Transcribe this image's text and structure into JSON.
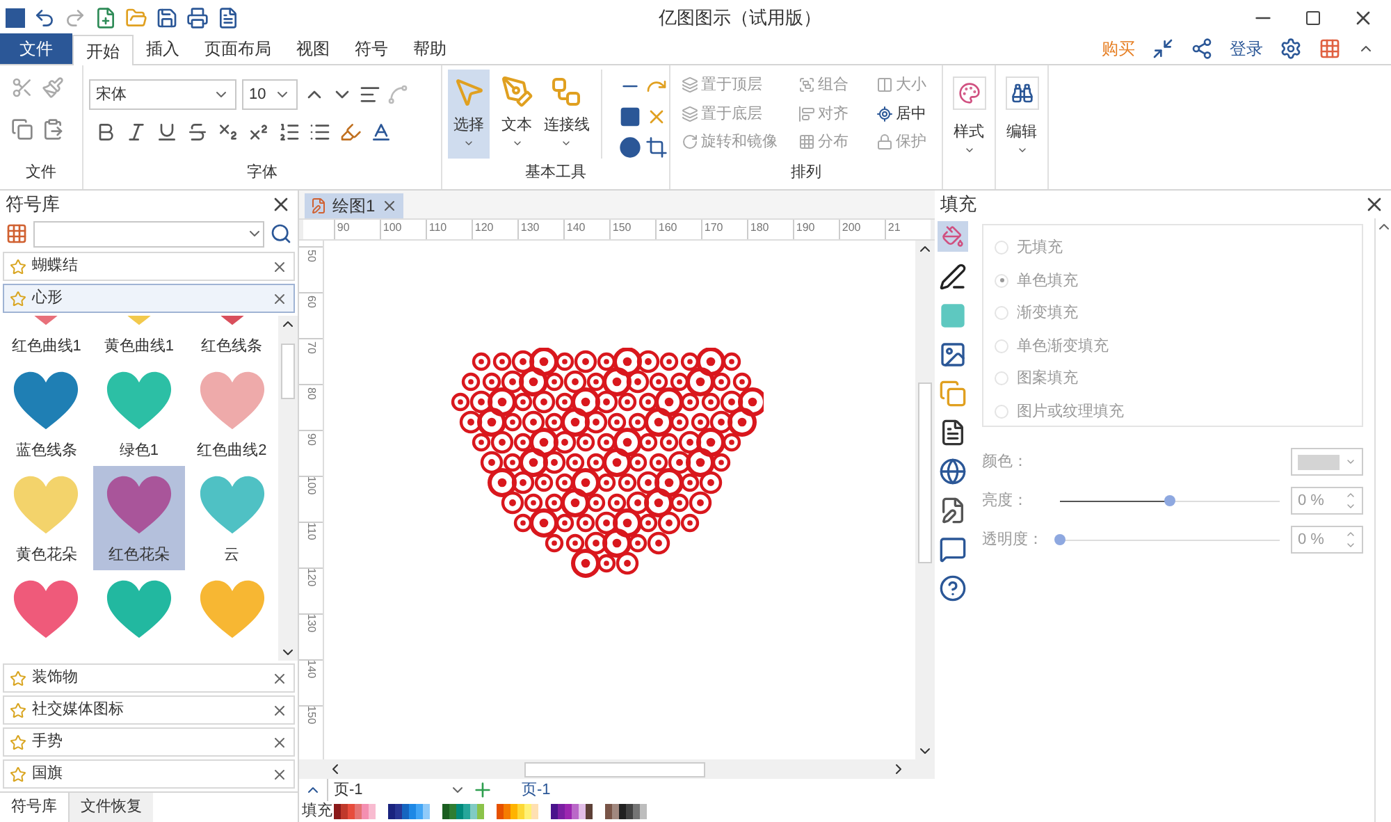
{
  "window": {
    "title": "亿图图示（试用版）"
  },
  "menu_tabs": [
    {
      "label": "文件",
      "kind": "file",
      "selected": false
    },
    {
      "label": "开始",
      "kind": "tab",
      "selected": true
    },
    {
      "label": "插入",
      "kind": "tab",
      "selected": false
    },
    {
      "label": "页面布局",
      "kind": "tab",
      "selected": false
    },
    {
      "label": "视图",
      "kind": "tab",
      "selected": false
    },
    {
      "label": "符号",
      "kind": "tab",
      "selected": false
    },
    {
      "label": "帮助",
      "kind": "tab",
      "selected": false
    }
  ],
  "account": {
    "buy": "购买",
    "login": "登录"
  },
  "ribbon": {
    "font_name": "宋体",
    "font_size": "10",
    "groups": [
      "文件",
      "字体",
      "基本工具",
      "排列"
    ],
    "tools": [
      {
        "label": "选择",
        "selected": true
      },
      {
        "label": "文本",
        "selected": false
      },
      {
        "label": "连接线",
        "selected": false
      }
    ],
    "arrange": [
      {
        "label": "置于顶层"
      },
      {
        "label": "组合"
      },
      {
        "label": "大小"
      },
      {
        "label": "置于底层"
      },
      {
        "label": "对齐"
      },
      {
        "label": "居中"
      },
      {
        "label": "旋转和镜像"
      },
      {
        "label": "分布"
      },
      {
        "label": "保护"
      }
    ],
    "style": "样式",
    "edit": "编辑"
  },
  "library": {
    "title": "符号库",
    "categories": [
      {
        "label": "蝴蝶结",
        "expanded": false
      },
      {
        "label": "心形",
        "expanded": true
      },
      {
        "label": "装饰物",
        "expanded": false
      },
      {
        "label": "社交媒体图标",
        "expanded": false
      },
      {
        "label": "手势",
        "expanded": false
      },
      {
        "label": "国旗",
        "expanded": false
      }
    ],
    "items": [
      {
        "label": "红色曲线1",
        "color": "#e8707a",
        "selected": false
      },
      {
        "label": "黄色曲线1",
        "color": "#f2c94c",
        "selected": false
      },
      {
        "label": "红色线条",
        "color": "#d94f5c",
        "selected": false
      },
      {
        "label": "蓝色线条",
        "color": "#1f7fb4",
        "selected": false
      },
      {
        "label": "绿色1",
        "color": "#2cbfa5",
        "selected": false
      },
      {
        "label": "红色曲线2",
        "color": "#eeaaaa",
        "selected": false
      },
      {
        "label": "黄色花朵",
        "color": "#f3d36b",
        "selected": false
      },
      {
        "label": "红色花朵",
        "color": "#a9559a",
        "selected": true
      },
      {
        "label": "云",
        "color": "#4fc1c4",
        "selected": false
      },
      {
        "color": "#ef5a7a",
        "selected": false
      },
      {
        "color": "#22b8a0",
        "selected": false
      },
      {
        "color": "#f7b733",
        "selected": false
      }
    ],
    "bottom_tabs": [
      {
        "label": "符号库",
        "selected": true
      },
      {
        "label": "文件恢复",
        "selected": false
      }
    ]
  },
  "document": {
    "tab": "绘图1",
    "h_ruler": [
      "90",
      "100",
      "110",
      "120",
      "130",
      "140",
      "150",
      "160",
      "170",
      "180",
      "190",
      "200",
      "21"
    ],
    "v_ruler": [
      "50",
      "60",
      "70",
      "80",
      "90",
      "100",
      "110",
      "120",
      "130",
      "140",
      "150"
    ],
    "page_select": "页-1",
    "page_tab": "页-1",
    "palette_label": "填充"
  },
  "fill_panel": {
    "title": "填充",
    "options": [
      {
        "label": "无填充",
        "selected": false
      },
      {
        "label": "单色填充",
        "selected": true
      },
      {
        "label": "渐变填充",
        "selected": false
      },
      {
        "label": "单色渐变填充",
        "selected": false
      },
      {
        "label": "图案填充",
        "selected": false
      },
      {
        "label": "图片或纹理填充",
        "selected": false
      }
    ],
    "color_label": "颜色：",
    "sliders": [
      {
        "label": "亮度：",
        "level": 0.5,
        "reading": "0 %"
      },
      {
        "label": "透明度：",
        "level": 0,
        "reading": "0 %"
      }
    ]
  }
}
